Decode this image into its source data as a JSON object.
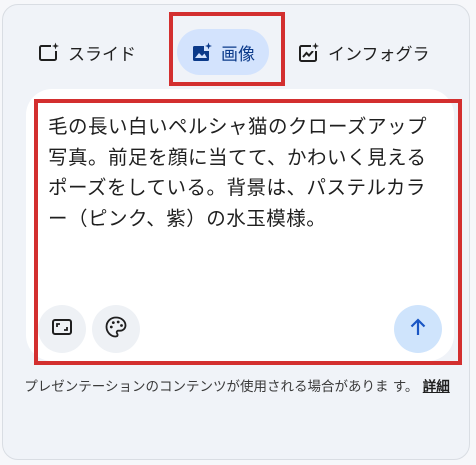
{
  "tabs": [
    {
      "label": "スライド",
      "icon": "slide-sparkle-icon",
      "selected": false
    },
    {
      "label": "画像",
      "icon": "image-sparkle-icon",
      "selected": true
    },
    {
      "label": "インフォグラ",
      "icon": "chart-sparkle-icon",
      "selected": false
    }
  ],
  "prompt": {
    "value": "毛の長い白いペルシャ猫のクローズアップ写真。前足を顔に当てて、かわいく見えるポーズをしている。背景は、パステルカラー（ピンク、紫）の水玉模様。"
  },
  "controls": {
    "aspect_icon": "aspect-ratio-icon",
    "style_icon": "palette-icon",
    "send_icon": "arrow-up-icon"
  },
  "footer": {
    "text": "プレゼンテーションのコンテンツが使用される場合がありま す。",
    "link": "詳細"
  },
  "colors": {
    "accent": "#d3e3fd",
    "highlight": "#d32f2f",
    "send_bg": "#cfe4fc",
    "send_icon": "#1a56c4"
  }
}
